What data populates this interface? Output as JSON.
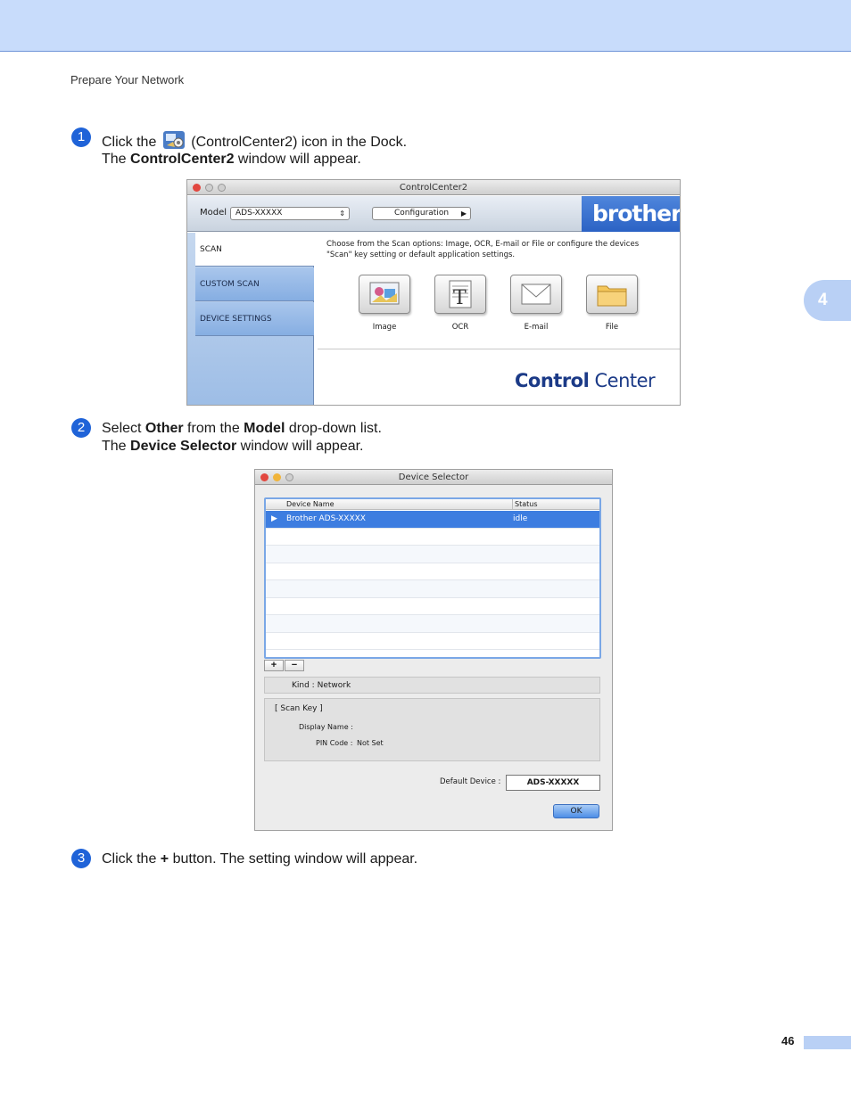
{
  "header": {
    "running_head": "Prepare Your Network"
  },
  "chapter_tab": "4",
  "steps": [
    {
      "number": "1",
      "line1": {
        "pre": "Click the ",
        "post": " (ControlCenter2) icon in the Dock."
      },
      "line2": {
        "pre": "The ",
        "bold": "ControlCenter2",
        "post": " window will appear."
      }
    },
    {
      "number": "2",
      "line1": {
        "pre": "Select ",
        "bold1": "Other",
        "mid": " from the ",
        "bold2": "Model",
        "post": " drop-down list."
      },
      "line2": {
        "pre": "The ",
        "bold": "Device Selector",
        "post": " window will appear."
      }
    },
    {
      "number": "3",
      "line1": {
        "pre": "Click the ",
        "bold": "+",
        "post": " button. The setting window will appear."
      }
    }
  ],
  "controlcenter": {
    "title": "ControlCenter2",
    "model_label": "Model",
    "model_value": "ADS-XXXXX",
    "configuration_label": "Configuration",
    "brand": "brother",
    "sidebar": [
      "SCAN",
      "CUSTOM SCAN",
      "DEVICE SETTINGS"
    ],
    "description_line1": "Choose from the Scan options: Image, OCR, E-mail or File or configure the devices",
    "description_line2": "\"Scan\" key setting or default application settings.",
    "buttons": [
      "Image",
      "OCR",
      "E-mail",
      "File"
    ],
    "logo_bold": "Control",
    "logo_light": " Center"
  },
  "device_selector": {
    "title": "Device Selector",
    "columns": [
      "Device Name",
      "Status"
    ],
    "rows": [
      {
        "name": "Brother ADS-XXXXX",
        "status": "idle"
      }
    ],
    "add_label": "+",
    "remove_label": "−",
    "kind_label": "Kind :",
    "kind_value": "Network",
    "scan_key_title": "[ Scan Key ]",
    "display_name_label": "Display Name :",
    "pin_code_label": "PIN Code :",
    "pin_code_value": "Not Set",
    "default_device_label": "Default Device :",
    "default_device_value": "ADS-XXXXX",
    "ok_label": "OK"
  },
  "footer": {
    "page_number": "46"
  },
  "colors": {
    "accent": "#1f63d8",
    "band": "#c8dcfb",
    "tab": "#b9d0f5",
    "selection": "#3d7de0"
  }
}
